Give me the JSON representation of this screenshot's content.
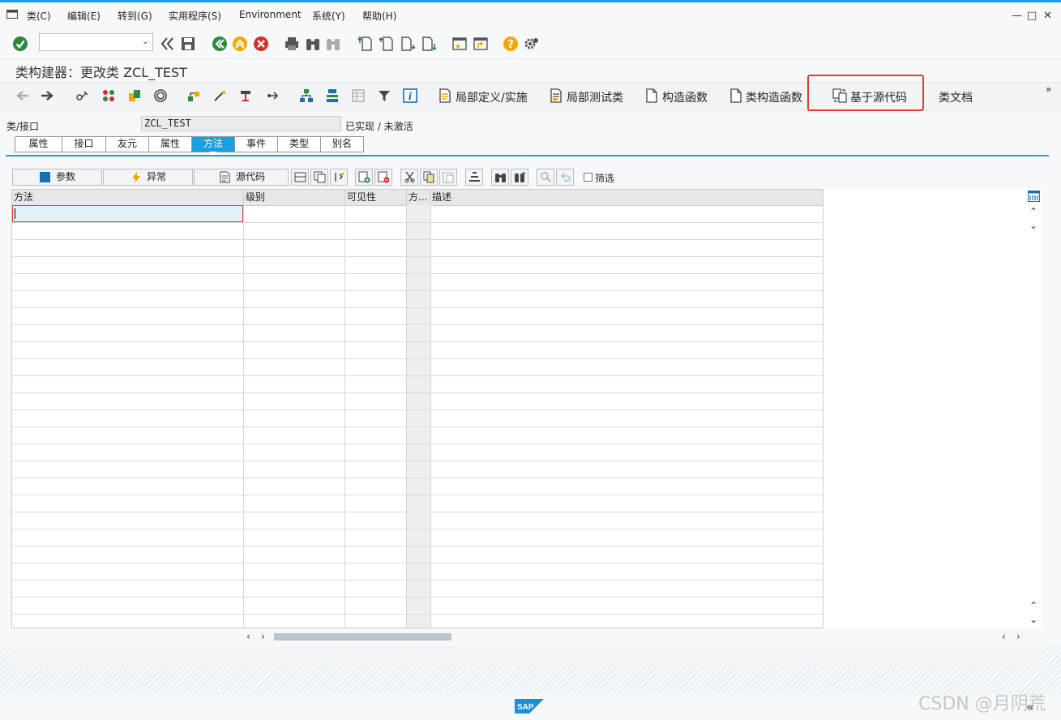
{
  "menubar": {
    "items": [
      "类(C)",
      "编辑(E)",
      "转到(G)",
      "实用程序(S)",
      "Environment",
      "系统(Y)",
      "帮助(H)"
    ]
  },
  "window_controls": {
    "minimize": "—",
    "maximize": "□",
    "close": "✕"
  },
  "title": "类构建器：更改类 ZCL_TEST",
  "app_toolbar": {
    "buttons": [
      "局部定义/实施",
      "局部测试类",
      "构造函数",
      "类构造函数",
      "基于源代码",
      "类文档"
    ],
    "more": "»"
  },
  "class_row": {
    "label": "类/接口",
    "value": "ZCL_TEST",
    "status": "已实现 / 未激活"
  },
  "tabs": [
    "属性",
    "接口",
    "友元",
    "属性",
    "方法",
    "事件",
    "类型",
    "别名"
  ],
  "active_tab": "方法",
  "inner_toolbar": {
    "params": "参数",
    "exceptions": "异常",
    "source": "源代码",
    "filter": "筛选"
  },
  "grid": {
    "columns": [
      "方法",
      "级别",
      "可见性",
      "方...",
      "描述"
    ],
    "rows": []
  },
  "colors": {
    "accent": "#1a9fe0",
    "highlight": "#e53935"
  },
  "footer": {
    "sap": "SAP",
    "watermark": "CSDN @月阴荒",
    "collapse": "«"
  }
}
